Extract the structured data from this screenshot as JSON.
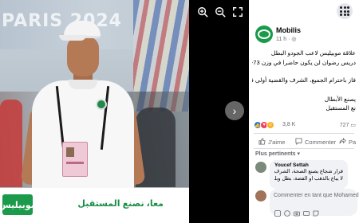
{
  "photo": {
    "background_text": "PARIS 2024",
    "brand_logo": "موبيليس",
    "slogan": "معا، نصنع المستقبل"
  },
  "viewer": {
    "zoom_in_icon": "zoom-in-icon",
    "zoom_out_icon": "zoom-out-icon",
    "fullscreen_icon": "fullscreen-icon",
    "next_icon": "chevron-right-icon"
  },
  "post": {
    "page_name": "Mobilis",
    "time": "11 h",
    "privacy_icon": "globe-icon",
    "text_lines": [
      "علاقة موبيليس لاعب الجودو البطل",
      "دريس رضوان لن يكون حاضرا في وزن 73- كلغ",
      "",
      "فاز باحترام الجميع، الشرف والقضية أولى في كل شيء",
      "",
      "يصنع الأبطال",
      "نع المستقبل"
    ],
    "reaction_count": "3,8 K",
    "comment_count": "727",
    "actions": {
      "like": "J'aime",
      "comment": "Commenter",
      "share": "Pa"
    },
    "sort_label": "Plus pertinents"
  },
  "comment": {
    "author": "Youcef Settah",
    "lines": [
      "قرار شجاع يصنع الصحة، الشرف",
      "لا يباع بالذهب او الفضة، بطل وبلى"
    ]
  },
  "composer": {
    "placeholder": "Commenter en tant que Mohamed"
  },
  "colors": {
    "brand_green": "#1a9a4a",
    "like_blue": "#1877f2",
    "love_red": "#f33e58",
    "haha_yellow": "#f7b125"
  }
}
